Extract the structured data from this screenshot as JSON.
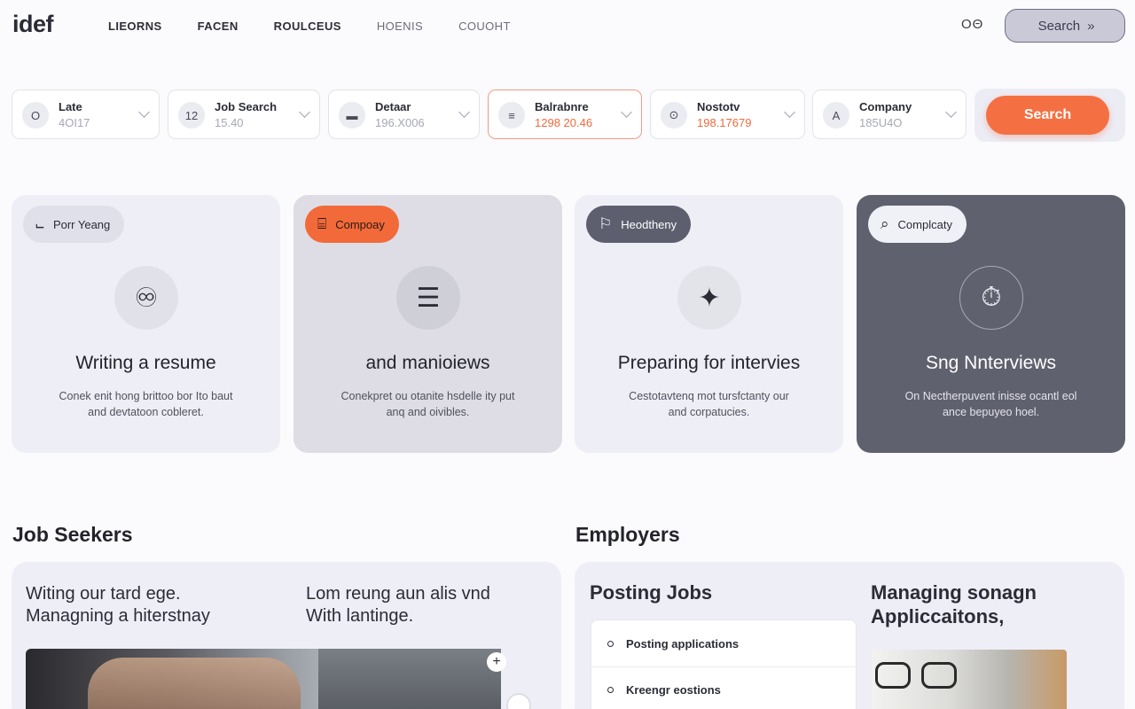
{
  "nav": {
    "logo": "idef",
    "links": [
      "LIEORNS",
      "FACEN",
      "ROULCEUS",
      "HOENIS",
      "COUOHT"
    ],
    "glyph": "OΘ",
    "search_label": "Search",
    "search_chevron": "»"
  },
  "filters": [
    {
      "icon": "O",
      "label": "Late",
      "value": "4OI17"
    },
    {
      "icon": "12",
      "label": "Job Search",
      "value": "15.40"
    },
    {
      "icon": "▬",
      "label": "Detaar",
      "value": "196.X006"
    },
    {
      "icon": "≡",
      "label": "Balrabnre",
      "value": "1298 20.46"
    },
    {
      "icon": "⊙",
      "label": "Nostotv",
      "value": "198.17679"
    },
    {
      "icon": "A",
      "label": "Company",
      "value": "185U4O"
    }
  ],
  "search_button": "Search",
  "cards": [
    {
      "tag_icon": "⨽",
      "tag": "Porr Yeang",
      "icon": "♾",
      "title": "Writing a resume",
      "desc_1": "Conek enit hong brittoo bor Ito baut",
      "desc_2": "and devtatoon cobleret."
    },
    {
      "tag_icon": "⌸",
      "tag": "Compoay",
      "icon": "☰",
      "title": "and manioiews",
      "desc_1": "Conekpret ou otanite hsdelle ity put",
      "desc_2": "anq and oivibles."
    },
    {
      "tag_icon": "⚐",
      "tag": "Heodtheny",
      "icon": "✦",
      "title": "Preparing for intervies",
      "desc_1": "Cestotavtenq mot tursfctanty our",
      "desc_2": "and corpatucies."
    },
    {
      "tag_icon": "⌕",
      "tag": "Complcaty",
      "icon": "⏱",
      "title": "Sng Nnterviews",
      "desc_1": "On Nectherpuvent inisse ocantl eol",
      "desc_2": "ance bepuyeo hoel."
    }
  ],
  "job_seekers": {
    "title": "Job Seekers",
    "left_line1": "Witing our tard ege.",
    "left_line2": "Managning a hiterstnay",
    "right_line1": "Lom reung aun alis vnd",
    "right_line2": "With lantinge.",
    "plus": "+"
  },
  "employers": {
    "title": "Employers",
    "posting_title": "Posting Jobs",
    "items": [
      "Posting applications",
      "Kreengr eostions"
    ],
    "managing_line1": "Managing sonagn",
    "managing_line2": "Appliccaitons,"
  }
}
